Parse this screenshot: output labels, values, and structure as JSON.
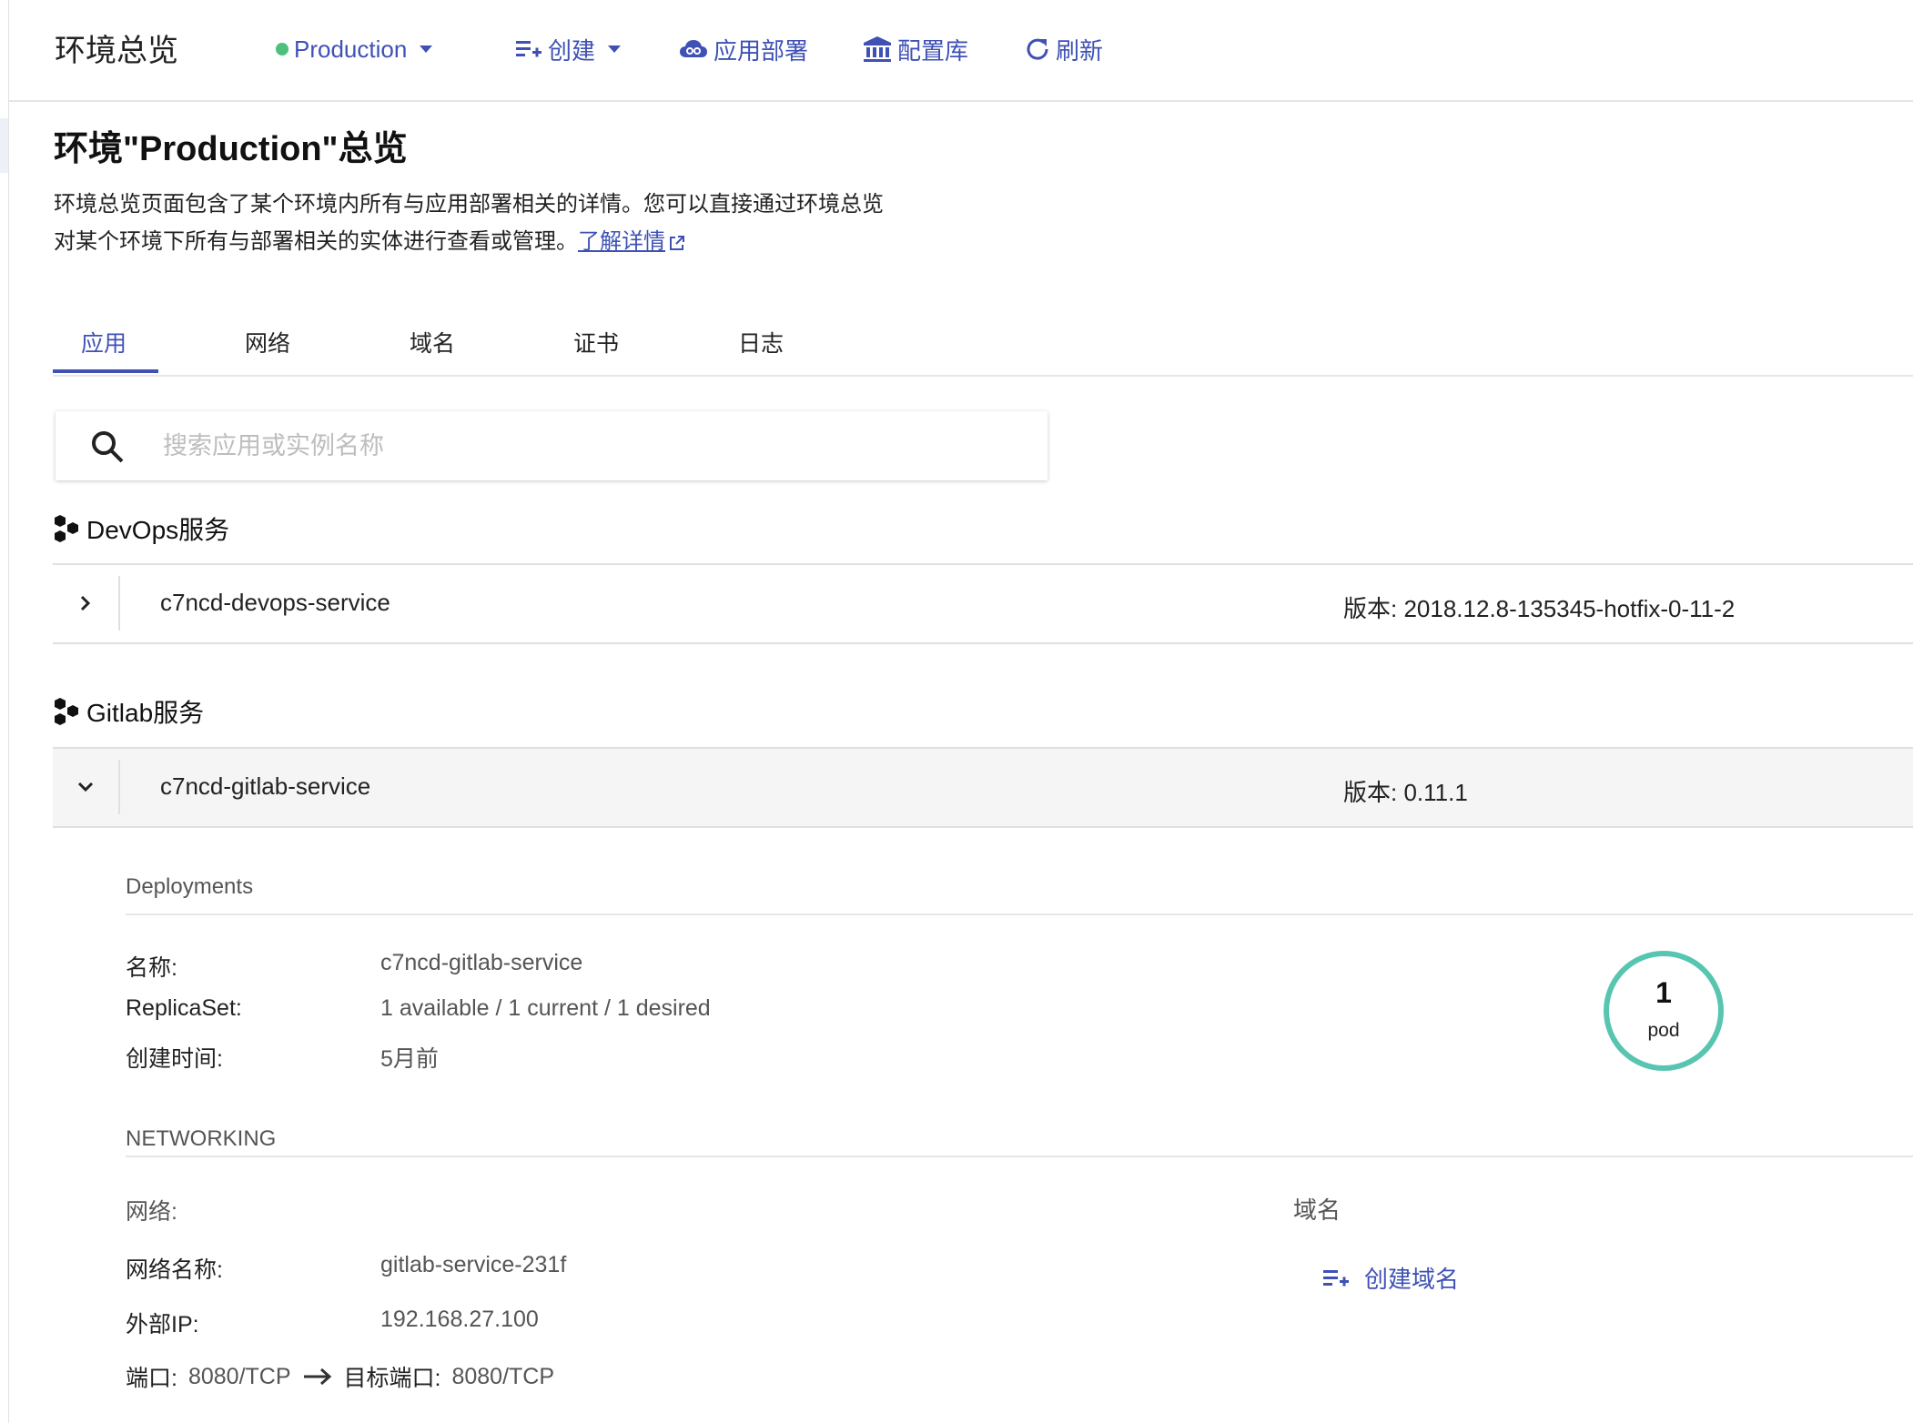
{
  "topbar": {
    "title": "环境总览",
    "env": {
      "label": "Production",
      "dot_color": "#4ec07d"
    },
    "create_label": "创建",
    "deploy_label": "应用部署",
    "config_label": "配置库",
    "refresh_label": "刷新"
  },
  "page": {
    "title": "环境\"Production\"总览",
    "desc_line1": "环境总览页面包含了某个环境内所有与应用部署相关的详情。您可以直接通过环境总览",
    "desc_line2": "对某个环境下所有与部署相关的实体进行查看或管理。",
    "learn_more": "了解详情"
  },
  "tabs": [
    {
      "label": "应用",
      "active": true
    },
    {
      "label": "网络",
      "active": false
    },
    {
      "label": "域名",
      "active": false
    },
    {
      "label": "证书",
      "active": false
    },
    {
      "label": "日志",
      "active": false
    }
  ],
  "search": {
    "placeholder": "搜索应用或实例名称"
  },
  "groups": [
    {
      "title": "DevOps服务",
      "app": {
        "name": "c7ncd-devops-service",
        "version_label": "版本:",
        "version": "2018.12.8-135345-hotfix-0-11-2",
        "expanded": false
      }
    },
    {
      "title": "Gitlab服务",
      "app": {
        "name": "c7ncd-gitlab-service",
        "version_label": "版本:",
        "version": "0.11.1",
        "expanded": true
      }
    }
  ],
  "deployment": {
    "section": "Deployments",
    "name_label": "名称:",
    "name": "c7ncd-gitlab-service",
    "replicaset_label": "ReplicaSet:",
    "replicaset": "1 available / 1 current / 1 desired",
    "created_label": "创建时间:",
    "created": "5月前",
    "pods": "1",
    "pods_unit": "pod",
    "ring_color": "#57c5b0"
  },
  "networking": {
    "section": "NETWORKING",
    "network_label": "网络:",
    "domain_label": "域名",
    "network_name_label": "网络名称:",
    "network_name": "gitlab-service-231f",
    "external_ip_label": "外部IP:",
    "external_ip": "192.168.27.100",
    "port_label": "端口:",
    "port": "8080/TCP",
    "target_port_label": "目标端口:",
    "target_port": "8080/TCP",
    "create_domain": "创建域名"
  },
  "colors": {
    "accent": "#3f51b5",
    "env_status": "#4ec07d"
  }
}
